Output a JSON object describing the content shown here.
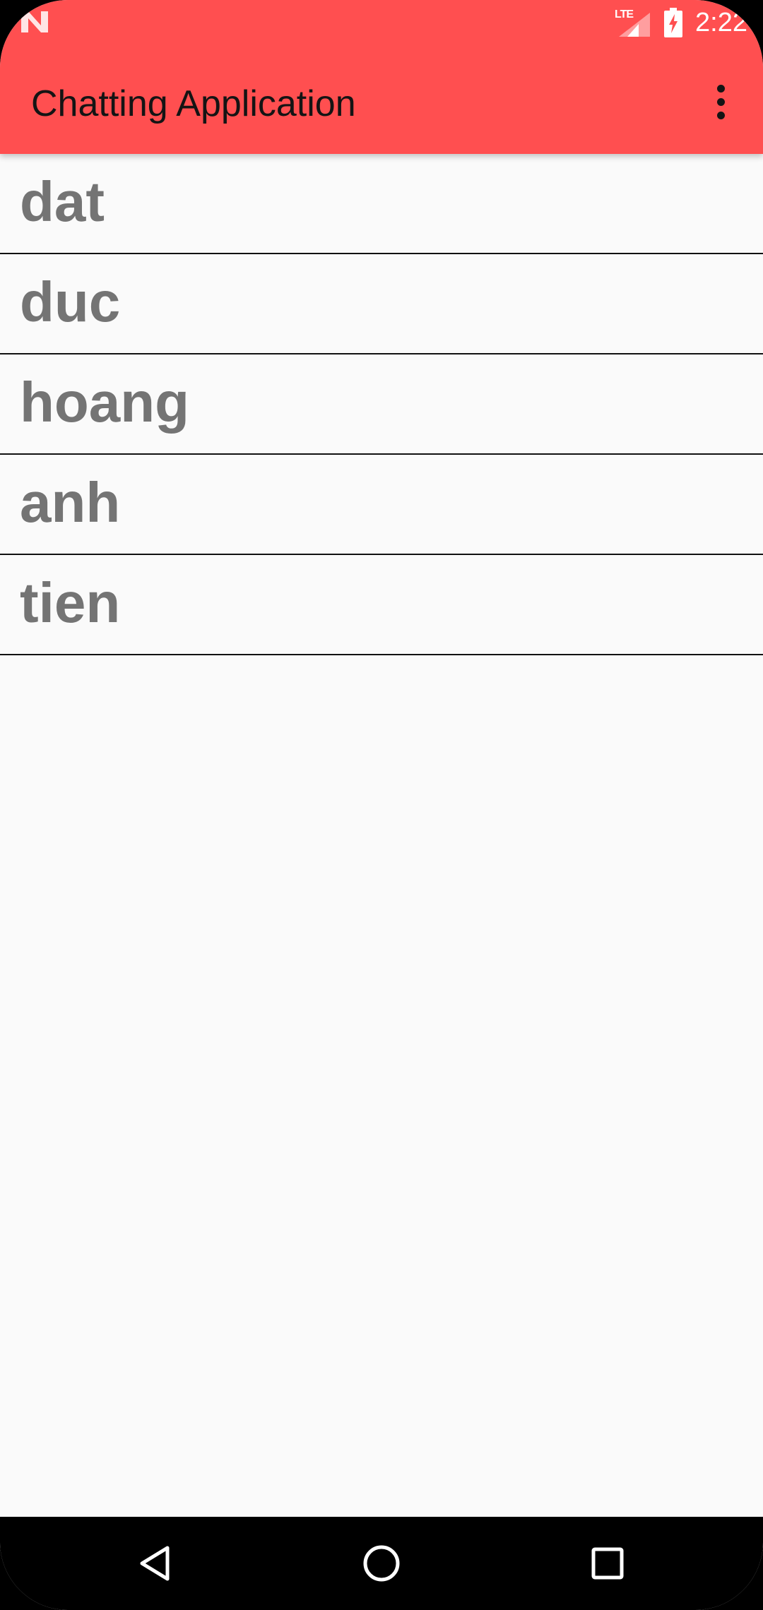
{
  "status_bar": {
    "time": "2:22",
    "network_label": "LTE",
    "icons": [
      "notification-n-icon",
      "signal-icon",
      "battery-charging-icon"
    ]
  },
  "toolbar": {
    "title": "Chatting Application",
    "overflow_icon": "more-vert-icon"
  },
  "users": [
    {
      "name": "dat"
    },
    {
      "name": "duc"
    },
    {
      "name": "hoang"
    },
    {
      "name": "anh"
    },
    {
      "name": "tien"
    }
  ],
  "nav_bar": {
    "buttons": [
      "back-icon",
      "home-icon",
      "recents-icon"
    ]
  },
  "colors": {
    "app_bar": "#FF4F50",
    "background": "#FAFAFA",
    "list_text": "#747474",
    "divider": "#111111",
    "title_text": "#141414"
  }
}
